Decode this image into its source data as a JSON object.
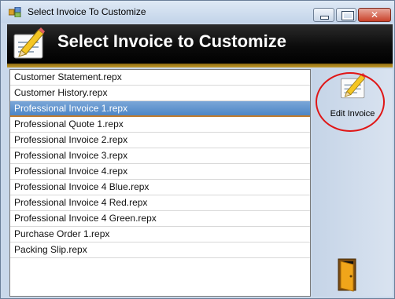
{
  "window": {
    "title": "Select Invoice To Customize"
  },
  "banner": {
    "title": "Select Invoice to Customize"
  },
  "list": {
    "selected_index": 2,
    "items": [
      "Customer Statement.repx",
      "Customer History.repx",
      "Professional Invoice 1.repx",
      "Professional Quote 1.repx",
      "Professional Invoice 2.repx",
      "Professional Invoice 3.repx",
      "Professional Invoice 4.repx",
      "Professional Invoice 4 Blue.repx",
      "Professional Invoice 4 Red.repx",
      "Professional Invoice 4 Green.repx",
      "Purchase Order 1.repx",
      "Packing Slip.repx"
    ]
  },
  "panel": {
    "edit_label": "Edit Invoice",
    "edit_icon": "pencil-document-icon",
    "exit_icon": "exit-door-icon"
  },
  "colors": {
    "banner_bg": "#000000",
    "banner_accent": "#c49a2a",
    "selection": "#5a8fcb",
    "highlight_ring": "#e01616"
  }
}
